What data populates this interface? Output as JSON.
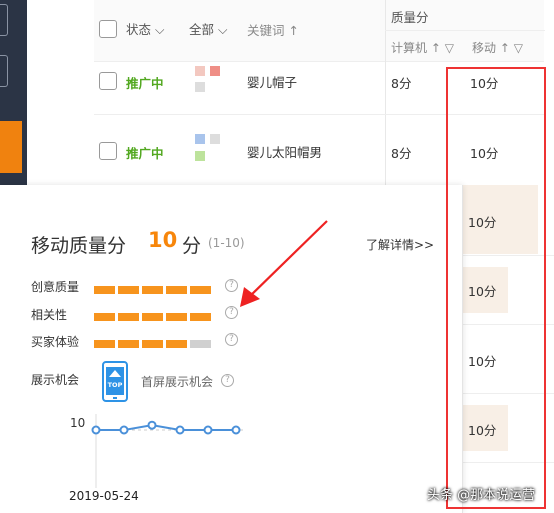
{
  "table": {
    "headers": {
      "status": "状态",
      "all": "全部",
      "keyword": "关键词 ↑",
      "quality": "质量分",
      "pc": "计算机 ↑",
      "mobile": "移动 ↑"
    },
    "rows": [
      {
        "status": "推广中",
        "keyword": "婴儿帽子",
        "pc": "8分",
        "mobile": "10分"
      },
      {
        "status": "推广中",
        "keyword": "婴儿太阳帽男",
        "pc": "8分",
        "mobile": "10分"
      }
    ],
    "extra_scores": [
      "10分",
      "10分",
      "10分",
      "10分"
    ]
  },
  "popup": {
    "title": "移动质量分",
    "score": "10",
    "unit": "分",
    "range": "(1-10)",
    "detail_link": "了解详情>>",
    "metrics": [
      {
        "label": "创意质量",
        "level": 5
      },
      {
        "label": "相关性",
        "level": 5
      },
      {
        "label": "买家体验",
        "level": 4
      }
    ],
    "display": {
      "label": "展示机会",
      "icon_text": "TOP",
      "value": "首屏展示机会"
    },
    "trend": {
      "y_label": "10",
      "x_label": "2019-05-24",
      "values": [
        10,
        10,
        10.4,
        10,
        10,
        10
      ]
    }
  },
  "watermark": "头条 @那本说运营",
  "colors": {
    "accent": "#f7860b",
    "status": "#52a820",
    "highlight": "#e33333",
    "blue": "#2e93e6"
  }
}
